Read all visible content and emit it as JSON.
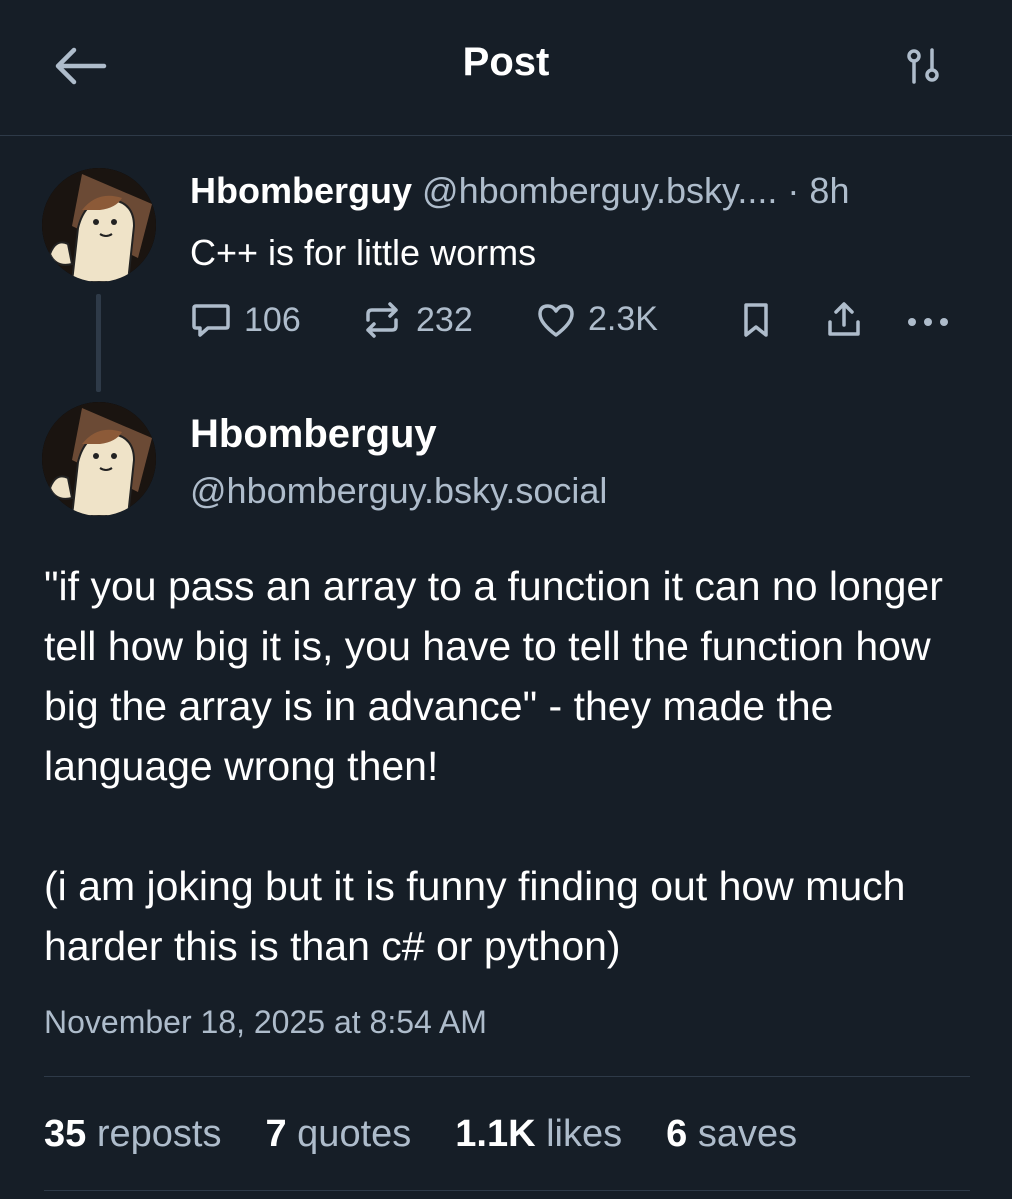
{
  "header": {
    "title": "Post",
    "back_icon": "arrow-left-icon",
    "filter_icon": "sliders-icon"
  },
  "reply": {
    "display_name": "Hbomberguy",
    "handle": "@hbomberguy.bsky....",
    "separator": "·",
    "time": "8h",
    "text": "C++ is for little worms",
    "actions": {
      "replies": "106",
      "reposts": "232",
      "likes": "2.3K"
    }
  },
  "post": {
    "display_name": "Hbomberguy",
    "handle": "@hbomberguy.bsky.social",
    "paragraphs": [
      "\"if you pass an array to a function it can no longer tell how big it is, you have to tell the function how big the array is in advance\" - they made the language wrong then!",
      "(i am joking but it is funny finding out how much harder this is than c# or python)"
    ],
    "timestamp": "November 18, 2025 at 8:54 AM",
    "stats": {
      "reposts_count": "35",
      "reposts_label": "reposts",
      "quotes_count": "7",
      "quotes_label": "quotes",
      "likes_count": "1.1K",
      "likes_label": "likes",
      "saves_count": "6",
      "saves_label": "saves"
    }
  },
  "colors": {
    "background": "#161e27",
    "muted": "#aebccb",
    "divider": "#2e3a48"
  }
}
